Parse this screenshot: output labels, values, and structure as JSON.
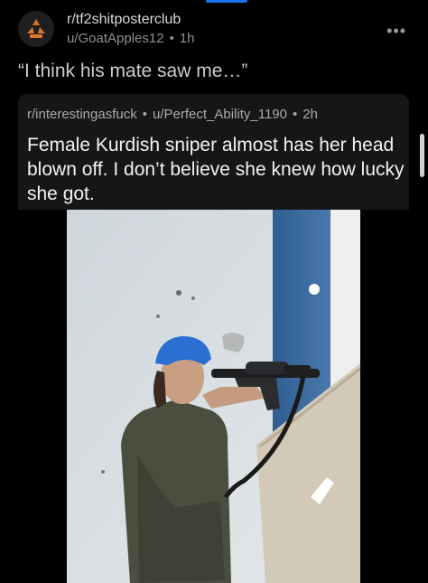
{
  "post": {
    "subreddit": "r/tf2shitposterclub",
    "author": "u/GoatApples12",
    "age": "1h",
    "title": "“I think his mate saw me…”"
  },
  "crosspost": {
    "subreddit": "r/interestingasfuck",
    "author": "u/Perfect_Ability_1190",
    "age": "2h",
    "title": "Female Kurdish sniper almost has her head blown off. I don’t believe she knew how lucky she got."
  },
  "icons": {
    "subreddit_avatar": "tf2-logo-icon",
    "more": "more-options-icon"
  },
  "colors": {
    "background": "#000000",
    "card": "#161617",
    "avatar_orange": "#d9762b",
    "accent_blue": "#1a73e8"
  }
}
